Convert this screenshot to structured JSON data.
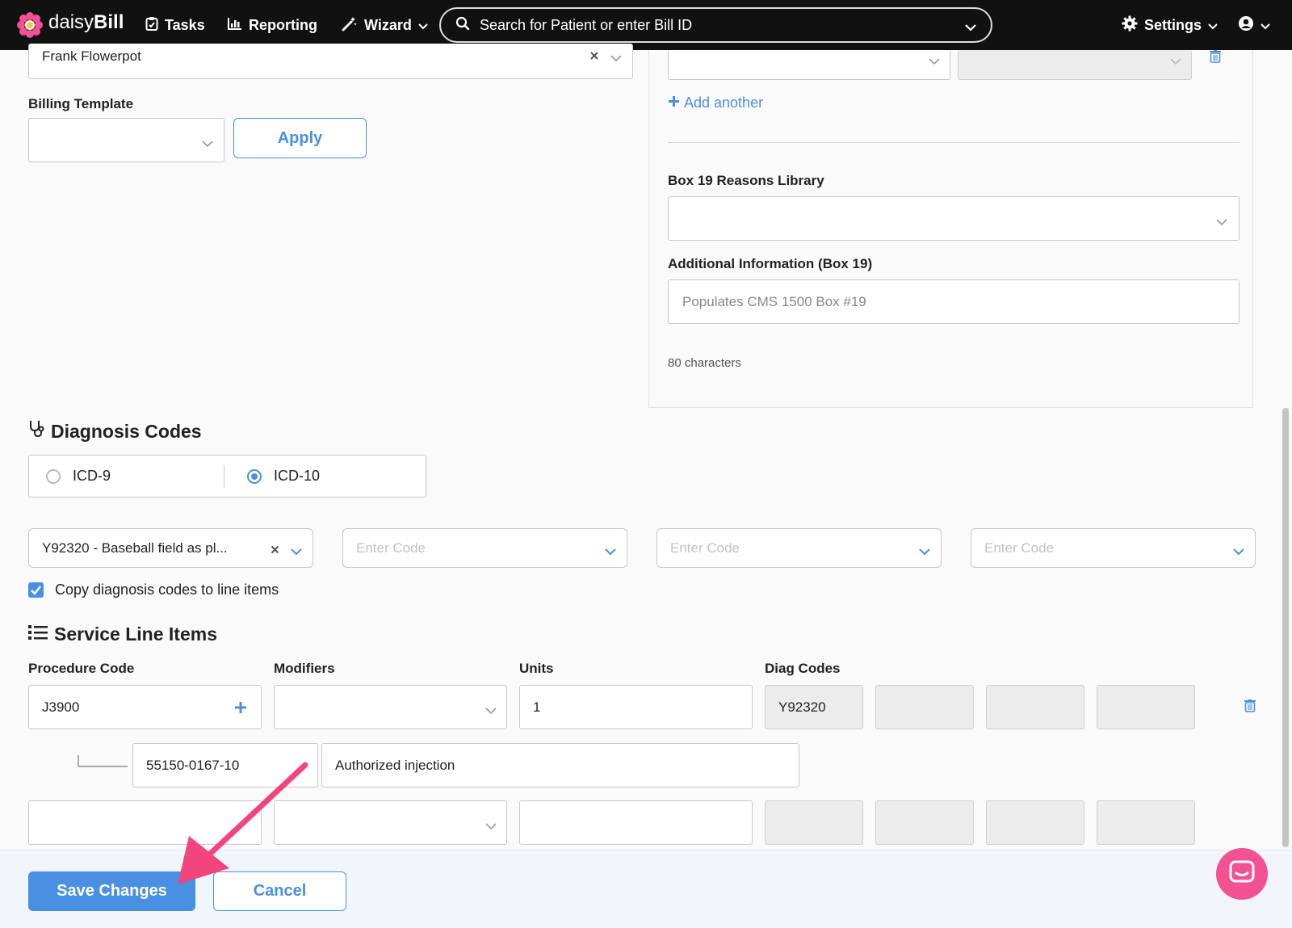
{
  "nav": {
    "brand": "daisyBill",
    "tasks": "Tasks",
    "reporting": "Reporting",
    "wizard": "Wizard",
    "search_placeholder": "Search for Patient or enter Bill ID",
    "settings": "Settings"
  },
  "left": {
    "provider_value": "Frank Flowerpot",
    "billing_template_label": "Billing Template",
    "apply_label": "Apply"
  },
  "right": {
    "add_another": "Add another",
    "box19_library_label": "Box 19 Reasons Library",
    "additional_info_label": "Additional Information (Box 19)",
    "additional_info_placeholder": "Populates CMS 1500 Box #19",
    "char_count": "80 characters"
  },
  "diagnosis": {
    "title": "Diagnosis Codes",
    "icd9": "ICD-9",
    "icd10": "ICD-10",
    "selected": "ICD-10",
    "code1": "Y92320 - Baseball field as pl...",
    "code_placeholder": "Enter Code",
    "copy_label": "Copy diagnosis codes to line items",
    "copy_checked": true
  },
  "service": {
    "title": "Service Line Items",
    "headers": {
      "procedure": "Procedure Code",
      "modifiers": "Modifiers",
      "units": "Units",
      "diag": "Diag Codes"
    },
    "row1": {
      "procedure": "J3900",
      "units": "1",
      "diag1": "Y92320"
    },
    "ndc": {
      "code": "55150-0167-10",
      "description": "Authorized injection"
    }
  },
  "footer": {
    "save": "Save Changes",
    "cancel": "Cancel"
  },
  "colors": {
    "accent": "#4a90e2",
    "nav_bg": "#111111",
    "arrow": "#f2457e",
    "chat": "#f25192"
  }
}
